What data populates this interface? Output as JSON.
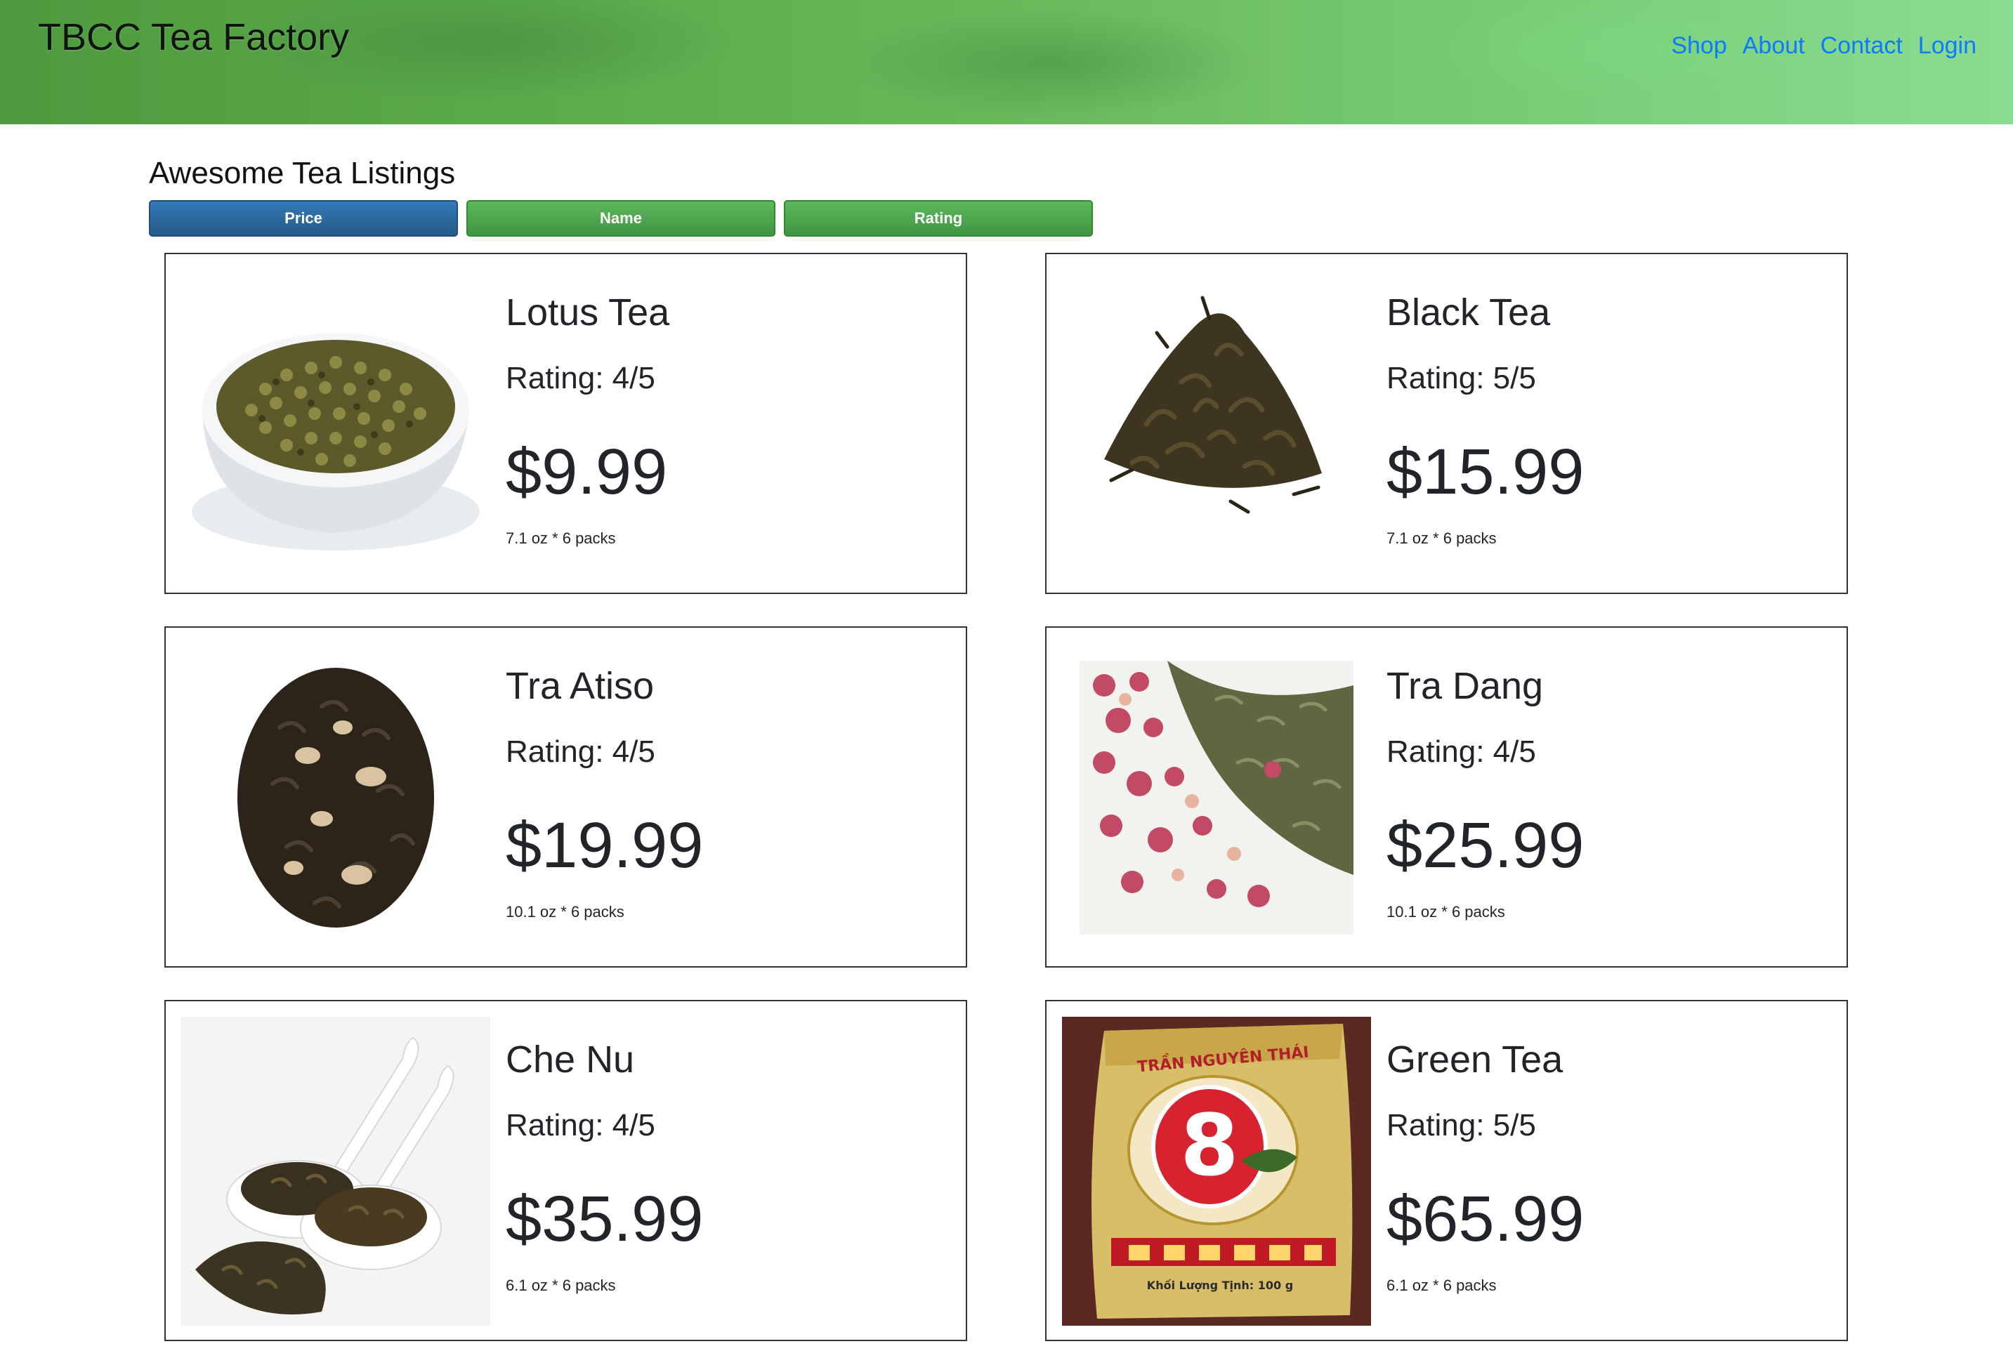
{
  "header": {
    "brand": "TBCC Tea Factory",
    "nav": [
      "Shop",
      "About",
      "Contact",
      "Login"
    ]
  },
  "listing": {
    "heading": "Awesome Tea Listings",
    "sort_buttons": [
      "Price",
      "Name",
      "Rating"
    ],
    "active_sort": "Price"
  },
  "products": [
    {
      "name": "Lotus Tea",
      "rating": "Rating: 4/5",
      "price": "$9.99",
      "size": "7.1 oz * 6 packs",
      "image": "bowl-of-rolled-tea-icon"
    },
    {
      "name": "Black Tea",
      "rating": "Rating: 5/5",
      "price": "$15.99",
      "size": "7.1 oz * 6 packs",
      "image": "loose-leaf-pile-icon"
    },
    {
      "name": "Tra Atiso",
      "rating": "Rating: 4/5",
      "price": "$19.99",
      "size": "10.1 oz * 6 packs",
      "image": "jasmine-leaf-pile-icon"
    },
    {
      "name": "Tra Dang",
      "rating": "Rating: 4/5",
      "price": "$25.99",
      "size": "10.1 oz * 6 packs",
      "image": "rosebud-tea-icon"
    },
    {
      "name": "Che Nu",
      "rating": "Rating: 4/5",
      "price": "$35.99",
      "size": "6.1 oz * 6 packs",
      "image": "tea-spoons-icon"
    },
    {
      "name": "Green Tea",
      "rating": "Rating: 5/5",
      "price": "$65.99",
      "size": "6.1 oz * 6 packs",
      "image": "tea-package-icon",
      "package_text": {
        "brand": "TRẦN NGUYÊN THÁI",
        "number": "8",
        "weight": "Khối Lượng Tịnh: 100 g"
      }
    }
  ],
  "colors": {
    "nav_link": "#0b7bff",
    "sort_active": "#337ab7",
    "sort_inactive": "#5cb85c"
  }
}
